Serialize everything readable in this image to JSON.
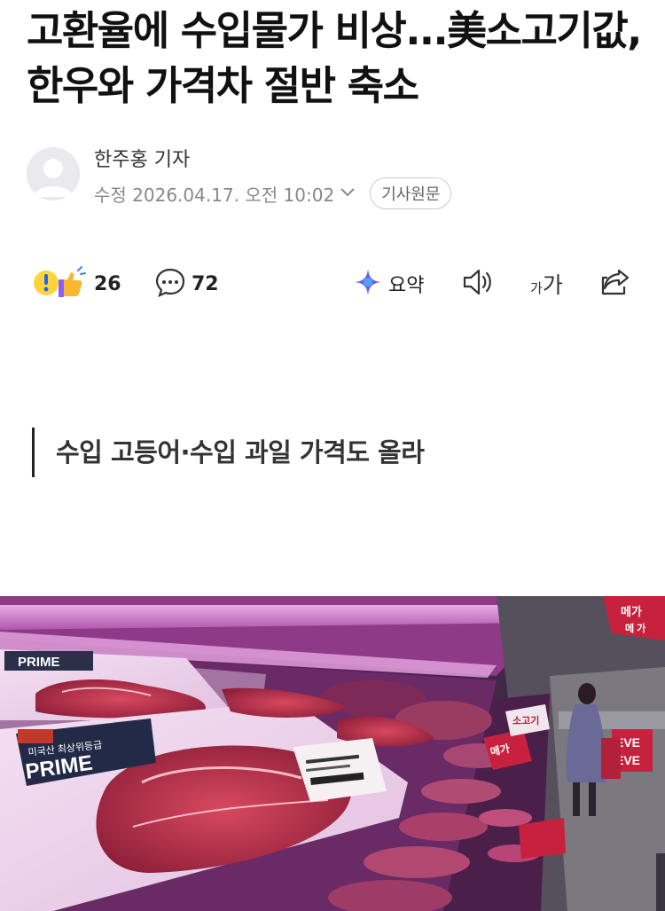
{
  "article": {
    "headline": "고환율에 수입물가 비상...美소고기값, 한우와 가격차 절반 축소",
    "reporter": "한주홍 기자",
    "modified": "수정 2026.04.17. 오전 10:02",
    "original_button": "기사원문",
    "subtitle": "수입 고등어·수입 과일 가격도 올라"
  },
  "toolbar": {
    "reaction_count": "26",
    "comment_count": "72",
    "summary_label": "요약",
    "font_small": "가",
    "font_large": "가"
  },
  "photo": {
    "label_prime_top": "PRIME",
    "label_prime_main": "PRIME",
    "label_grade": "미국산 최상위등급",
    "label_beef": "소고기",
    "label_mega": "메가",
    "label_eve": "EVE",
    "label_eve2": "EVE",
    "label_sign_top": "메가",
    "label_sign_top2": "메 가"
  },
  "icons": {
    "reaction": "reaction-icon",
    "comment": "comment-icon",
    "summary": "summary-sparkle-icon",
    "audio": "speaker-icon",
    "font": "font-size-icon",
    "share": "share-icon"
  }
}
